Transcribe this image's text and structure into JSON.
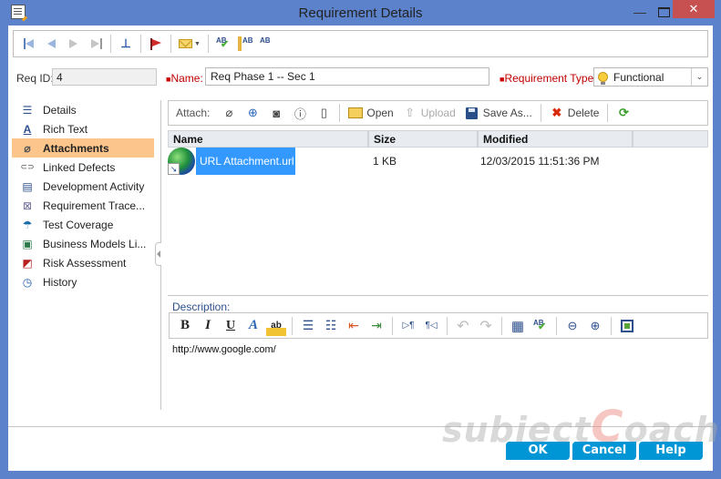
{
  "window": {
    "title": "Requirement Details",
    "minimize_glyph": "—",
    "close_glyph": "✕"
  },
  "main_toolbar": {
    "buttons": [
      {
        "name": "first-record",
        "icon": "first-icon"
      },
      {
        "name": "previous-record",
        "icon": "previous-icon"
      },
      {
        "name": "next-record",
        "icon": "next-icon"
      },
      {
        "name": "last-record",
        "icon": "last-icon"
      },
      {
        "name": "pin",
        "icon": "pin-icon"
      },
      {
        "name": "flag",
        "icon": "flag-icon"
      },
      {
        "name": "send-email",
        "icon": "mail-icon"
      },
      {
        "name": "spell-check",
        "icon": "spell-check-icon"
      },
      {
        "name": "thesaurus",
        "icon": "thesaurus-icon"
      },
      {
        "name": "spelling-options",
        "icon": "spelling-options-icon"
      }
    ],
    "pin_glyph": "⊥",
    "spell_check_label": "AB",
    "thesaurus_label": "AB",
    "spelling_options_label": "AB"
  },
  "fields": {
    "req_id_label": "Req ID:",
    "req_id_value": "4",
    "required_marker": "■",
    "name_label": "Name:",
    "name_value": "Req Phase 1 -- Sec 1",
    "type_label": "Requirement Type:",
    "type_value": "Functional",
    "type_caret": "⌄"
  },
  "sidebar": {
    "items": [
      {
        "label": "Details",
        "icon": "details-icon",
        "glyph": "☰",
        "active": false
      },
      {
        "label": "Rich Text",
        "icon": "rich-text-icon",
        "glyph": "A",
        "active": false
      },
      {
        "label": "Attachments",
        "icon": "paperclip-icon",
        "glyph": "⌀",
        "active": true
      },
      {
        "label": "Linked Defects",
        "icon": "link-icon",
        "glyph": "⊂⊃",
        "active": false
      },
      {
        "label": "Development Activity",
        "icon": "development-icon",
        "glyph": "▤",
        "active": false
      },
      {
        "label": "Requirement Trace...",
        "icon": "trace-icon",
        "glyph": "⊠",
        "active": false
      },
      {
        "label": "Test Coverage",
        "icon": "umbrella-icon",
        "glyph": "☂",
        "active": false
      },
      {
        "label": "Business Models Li...",
        "icon": "business-models-icon",
        "glyph": "▣",
        "active": false
      },
      {
        "label": "Risk Assessment",
        "icon": "risk-icon",
        "glyph": "◩",
        "active": false
      },
      {
        "label": "History",
        "icon": "history-icon",
        "glyph": "◷",
        "active": false
      }
    ]
  },
  "attach_toolbar": {
    "label": "Attach:",
    "paperclip_glyph": "⌀",
    "url_glyph": "⊕",
    "snapshot_glyph": "◙",
    "sysinfo_glyph": "ⓘ",
    "clipboard_glyph": "▯",
    "open_label": "Open",
    "upload_label": "Upload",
    "upload_glyph": "⇧",
    "save_as_label": "Save As...",
    "delete_label": "Delete",
    "delete_glyph": "✖",
    "refresh_glyph": "⟳"
  },
  "grid": {
    "columns": [
      "Name",
      "Size",
      "Modified",
      ""
    ],
    "rows": [
      {
        "name": "URL Attachment.url",
        "size": "1 KB",
        "modified": "12/03/2015 11:51:36 PM",
        "selected": true
      }
    ]
  },
  "description": {
    "label": "Description:",
    "toolbar": {
      "bold": "B",
      "italic": "I",
      "underline": "U",
      "font_color": "A",
      "highlight": "ab",
      "bullets": "☰",
      "numbering": "☷",
      "decrease_indent": "⇤",
      "increase_indent": "⇥",
      "ltr": "▷¶",
      "rtl": "¶◁",
      "undo": "↶",
      "redo": "↷",
      "table": "▦",
      "spell": "AB",
      "zoom_out": "⊖",
      "zoom_in": "⊕"
    },
    "text": "http://www.google.com/"
  },
  "watermark": {
    "part1": "subject",
    "part2": "C",
    "part3": "oach"
  },
  "buttons": {
    "ok": "OK",
    "cancel": "Cancel",
    "help": "Help"
  }
}
